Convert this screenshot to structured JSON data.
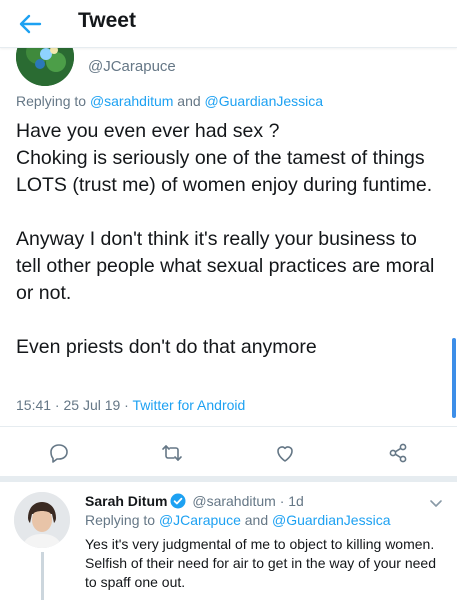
{
  "header": {
    "title": "Tweet",
    "back_icon": "arrow-left-icon"
  },
  "main_tweet": {
    "handle": "@JCarapuce",
    "replying_prefix": "Replying to ",
    "replying_mention_1": "@sarahditum",
    "replying_and": " and ",
    "replying_mention_2": "@GuardianJessica",
    "text": "Have you even ever had sex ?\nChoking is seriously one of the tamest of things LOTS (trust me) of women enjoy during funtime.\n\nAnyway I don't think it's really your business to tell other people what sexual practices are moral or not.\n\nEven priests don't do that anymore",
    "time_date": "15:41 · 25 Jul 19 · ",
    "client": "Twitter for Android"
  },
  "actions": {
    "reply_icon": "reply-icon",
    "retweet_icon": "retweet-icon",
    "like_icon": "heart-icon",
    "share_icon": "share-icon"
  },
  "reply_tweet": {
    "name": "Sarah Ditum",
    "handle_time": "@sarahditum · 1d",
    "replying_prefix": "Replying to ",
    "replying_mention_1": "@JCarapuce",
    "replying_and": " and ",
    "replying_mention_2": "@GuardianJessica",
    "text": "Yes it's very judgmental of me to object to killing women. Selfish of their need for air to get in the way of your need to spaff one out."
  },
  "colors": {
    "accent": "#1da1f2",
    "secondary_text": "#657786",
    "divider": "#e6ecf0"
  }
}
